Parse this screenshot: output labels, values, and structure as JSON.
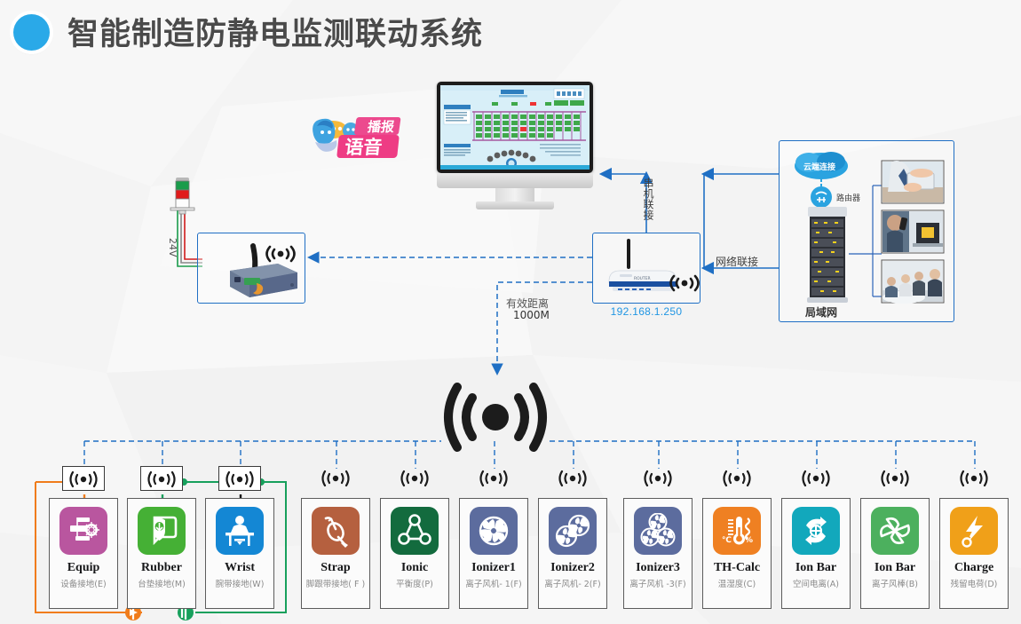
{
  "header": {
    "title": "智能制造防静电监测联动系统",
    "logo_icon": "blue-circle-logo",
    "accent_color": "#2aa9e8"
  },
  "diagram": {
    "voice_logo": {
      "icon": "voice-broadcast-mascot",
      "text": "语音播报"
    },
    "monitor": {
      "name": "监控主机",
      "icon": "desktop-monitor"
    },
    "tower_light": {
      "label": "24V",
      "icon": "andon-tower-light",
      "colors": [
        "#1a9c4b",
        "#e01b1b",
        "#ffffff"
      ]
    },
    "gateway": {
      "name": "无线网关",
      "icon": "wireless-gateway-box"
    },
    "router": {
      "name": "无线路由器",
      "icon": "wifi-router",
      "ip": "192.168.1.250"
    },
    "labels": {
      "serial_link": "串机联接",
      "network_link": "网络联接",
      "effective_distance_line1": "有效距离",
      "effective_distance_line2": "1000M"
    },
    "lan_panel": {
      "cloud": "云端连接",
      "router": "路由器",
      "lan": "局域网",
      "photos": [
        "tablet-user-photo",
        "phone-laptop-photo",
        "meeting-room-photo"
      ]
    },
    "hub": {
      "icon": "wireless-broadcast-hub"
    },
    "ground_loops": [
      {
        "name": "orange-ground-loop",
        "color": "#f07c1b"
      },
      {
        "name": "green-ground-loop",
        "color": "#17a05c"
      }
    ]
  },
  "devices": [
    {
      "name": "Equip",
      "sub": "设备接地(E)",
      "color": "#b9569f",
      "icon": "equipment-ground-icon",
      "badge": "boxed",
      "dot": "#f07c1b"
    },
    {
      "name": "Rubber",
      "sub": "台垫接地(M)",
      "color": "#45b035",
      "icon": "mat-ground-icon",
      "badge": "boxed",
      "dot": "#17a05c"
    },
    {
      "name": "Wrist",
      "sub": "腕带接地(W)",
      "color": "#1487d4",
      "icon": "wrist-strap-icon",
      "badge": "boxed",
      "dot": "#111111"
    },
    {
      "name": "Strap",
      "sub": "脚跟带接地( F )",
      "color": "#b5603f",
      "icon": "heel-strap-icon",
      "badge": "plain",
      "dot": ""
    },
    {
      "name": "Ionic",
      "sub": "平衡度(P)",
      "color": "#136b3e",
      "icon": "ion-balance-icon",
      "badge": "plain",
      "dot": ""
    },
    {
      "name": "Ionizer1",
      "sub": "离子风机- 1(F)",
      "color": "#5c6c9e",
      "icon": "ionizer-fan-1-icon",
      "badge": "plain",
      "dot": ""
    },
    {
      "name": "Ionizer2",
      "sub": "离子风机- 2(F)",
      "color": "#5c6c9e",
      "icon": "ionizer-fan-2-icon",
      "badge": "plain",
      "dot": ""
    },
    {
      "name": "Ionizer3",
      "sub": "离子风机 -3(F)",
      "color": "#5c6c9e",
      "icon": "ionizer-fan-3-icon",
      "badge": "plain",
      "dot": ""
    },
    {
      "name": "TH-Calc",
      "sub": "温湿度(C)",
      "color": "#ef8022",
      "icon": "temp-humidity-icon",
      "badge": "plain",
      "dot": ""
    },
    {
      "name": "Ion Bar",
      "sub": "空间电离(A)",
      "color": "#12a8bc",
      "icon": "space-ionization-icon",
      "badge": "plain",
      "dot": ""
    },
    {
      "name": "Ion Bar",
      "sub": "离子风棒(B)",
      "color": "#4cb05e",
      "icon": "ion-bar-icon",
      "badge": "plain",
      "dot": ""
    },
    {
      "name": "Charge",
      "sub": "残留电荷(D)",
      "color": "#f0a019",
      "icon": "residual-charge-icon",
      "badge": "plain",
      "dot": ""
    }
  ]
}
